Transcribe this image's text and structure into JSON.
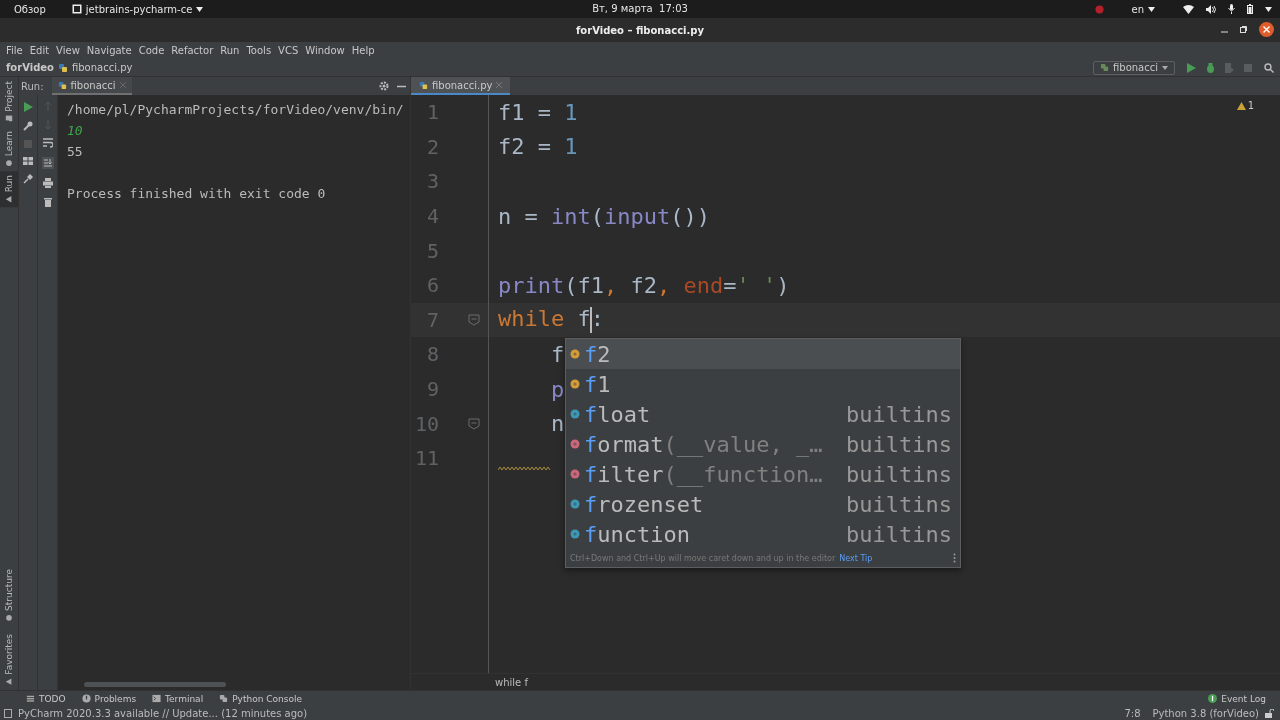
{
  "topbar": {
    "activities": "Обзор",
    "app_menu": "jetbrains-pycharm-ce",
    "clock": "Вт, 9 марта  17:03",
    "keyboard_layout": "en"
  },
  "window": {
    "title": "forVideo – fibonacci.py"
  },
  "menu": [
    "File",
    "Edit",
    "View",
    "Navigate",
    "Code",
    "Refactor",
    "Run",
    "Tools",
    "VCS",
    "Window",
    "Help"
  ],
  "navbar": {
    "breadcrumbs": [
      "forVideo",
      "fibonacci.py"
    ],
    "run_config": "fibonacci"
  },
  "left_stripe": [
    {
      "label": "Project",
      "selected": false
    },
    {
      "label": "Learn",
      "selected": false
    },
    {
      "label": "Run",
      "selected": true
    }
  ],
  "left_stripe_bottom": [
    "Structure",
    "Favorites"
  ],
  "run_panel": {
    "title": "Run:",
    "tab": {
      "label": "fibonacci",
      "selected": true
    },
    "console": [
      {
        "kind": "output",
        "text": "/home/pl/PycharmProjects/forVideo/venv/bin/"
      },
      {
        "kind": "input",
        "text": "10"
      },
      {
        "kind": "output",
        "text": "55"
      },
      {
        "kind": "blank"
      },
      {
        "kind": "output",
        "text": "Process finished with exit code 0"
      }
    ]
  },
  "editor": {
    "tabs": [
      {
        "label": "fibonacci.py",
        "selected": true
      }
    ],
    "problems": "1",
    "lines": [
      {
        "number": "1",
        "tokens": [
          {
            "kind": "plain",
            "text": "f1 = "
          },
          {
            "kind": "num",
            "text": "1"
          }
        ]
      },
      {
        "number": "2",
        "tokens": [
          {
            "kind": "plain",
            "text": "f2 = "
          },
          {
            "kind": "num",
            "text": "1"
          }
        ]
      },
      {
        "number": "3"
      },
      {
        "number": "4",
        "tokens": [
          {
            "kind": "plain",
            "text": "n = "
          },
          {
            "kind": "builtin",
            "text": "int"
          },
          {
            "kind": "plain",
            "text": "("
          },
          {
            "kind": "builtin",
            "text": "input"
          },
          {
            "kind": "plain",
            "text": "())"
          }
        ]
      },
      {
        "number": "5"
      },
      {
        "number": "6",
        "tokens": [
          {
            "kind": "builtin",
            "text": "print"
          },
          {
            "kind": "plain",
            "text": "(f1"
          },
          {
            "kind": "kw",
            "text": ","
          },
          {
            "kind": "plain",
            "text": " f2"
          },
          {
            "kind": "kw",
            "text": ","
          },
          {
            "kind": "param",
            "text": " end"
          },
          {
            "kind": "plain",
            "text": "="
          },
          {
            "kind": "str",
            "text": "' '"
          },
          {
            "kind": "plain",
            "text": ")"
          }
        ]
      },
      {
        "number": "7",
        "current": true,
        "fold": true,
        "tokens": [
          {
            "kind": "kw",
            "text": "while"
          },
          {
            "kind": "plain",
            "text": " f"
          },
          {
            "kind": "caret"
          },
          {
            "kind": "plain",
            "text": ":"
          }
        ]
      },
      {
        "number": "8",
        "tokens": [
          {
            "kind": "plain",
            "text": "    f"
          }
        ]
      },
      {
        "number": "9",
        "tokens": [
          {
            "kind": "builtin",
            "text": "    p"
          }
        ]
      },
      {
        "number": "10",
        "fold": true,
        "tokens": [
          {
            "kind": "plain",
            "text": "    n"
          }
        ]
      },
      {
        "number": "11",
        "tokens": [
          {
            "kind": "squiggle"
          }
        ]
      }
    ],
    "breadcrumb": "while f"
  },
  "completion": {
    "items": [
      {
        "kind": "variable",
        "selected": true,
        "prefix": "f",
        "name": "2"
      },
      {
        "kind": "variable",
        "selected": false,
        "prefix": "f",
        "name": "1"
      },
      {
        "kind": "class",
        "selected": false,
        "prefix": "f",
        "name": "loat",
        "source": "builtins"
      },
      {
        "kind": "function",
        "selected": false,
        "prefix": "f",
        "name": "ormat",
        "params": "(__value, _…",
        "source": "builtins"
      },
      {
        "kind": "function",
        "selected": false,
        "prefix": "f",
        "name": "ilter",
        "params": "(__function…",
        "source": "builtins"
      },
      {
        "kind": "class",
        "selected": false,
        "prefix": "f",
        "name": "rozenset",
        "source": "builtins"
      },
      {
        "kind": "class",
        "selected": false,
        "prefix": "f",
        "name": "unction",
        "source": "builtins"
      }
    ],
    "hint": "Ctrl+Down and Ctrl+Up will move caret down and up in the editor",
    "hint_link": "Next Tip"
  },
  "bottom_bar": {
    "tools": [
      {
        "kind": "todo",
        "label": "TODO"
      },
      {
        "kind": "problems",
        "label": "Problems"
      },
      {
        "kind": "terminal",
        "label": "Terminal"
      },
      {
        "kind": "console",
        "label": "Python Console"
      }
    ],
    "event_log": "Event Log"
  },
  "status_bar": {
    "message": "PyCharm 2020.3.3 available // Update... (12 minutes ago)",
    "position": "7:8",
    "interpreter": "Python 3.8 (forVideo)"
  }
}
